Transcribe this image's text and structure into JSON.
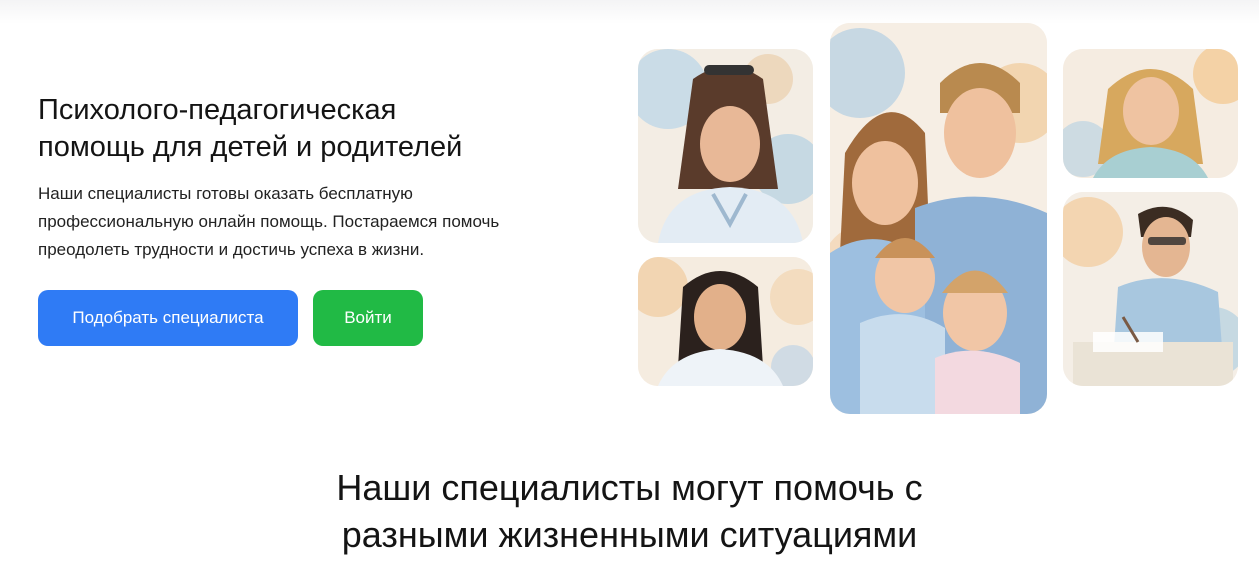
{
  "hero": {
    "title": "Психолого-педагогическая\nпомощь для детей и родителей",
    "description": "Наши специалисты готовы оказать бесплатную\nпрофессиональную онлайн помощь. Постараемся помочь\nпреодолеть трудности и достичь успеха в жизни.",
    "primary_button": "Подобрать специалиста",
    "login_button": "Войти"
  },
  "colors": {
    "primary": "#2f7bf5",
    "login": "#21ba45",
    "text": "#141414"
  },
  "gallery": {
    "images": [
      "woman-with-glasses-portrait",
      "asian-woman-portrait",
      "family-portrait",
      "smiling-blonde-woman-portrait",
      "man-writing-at-desk-portrait"
    ]
  },
  "section": {
    "title": "Наши специалисты могут помочь с\nразными жизненными ситуациями"
  }
}
